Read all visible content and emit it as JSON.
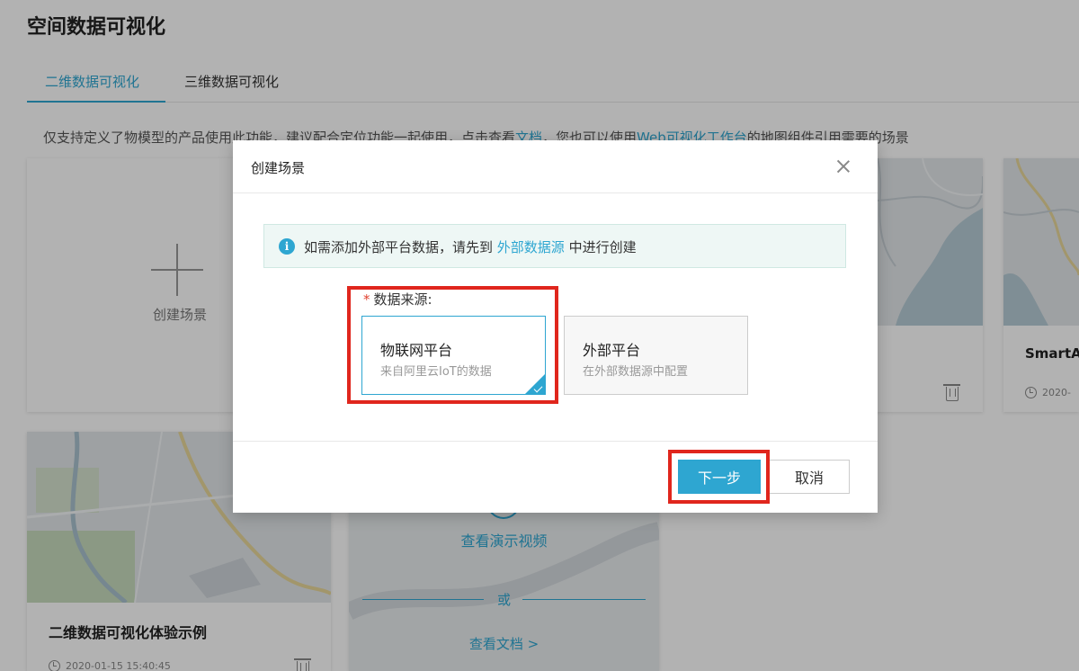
{
  "page": {
    "title": "空间数据可视化",
    "tabs": [
      {
        "label": "二维数据可视化",
        "active": true
      },
      {
        "label": "三维数据可视化",
        "active": false
      }
    ],
    "description": {
      "prefix": "仅支持定义了物模型的产品使用此功能，建议配合定位功能一起使用，点击查看",
      "doc_link": "文档",
      "middle": "，您也可以使用",
      "workbench_link": "Web可视化工作台",
      "suffix": "的地图组件引用需要的场景"
    }
  },
  "cards": {
    "create_label": "创建场景",
    "card_c_title": "SmartA",
    "card_c_date": "2020-",
    "card_d_title": "二维数据可视化体验示例",
    "card_d_date": "2020-01-15 15:40:45",
    "demo_video": "查看演示视频",
    "or": "或",
    "view_doc": "查看文档 >"
  },
  "modal": {
    "title": "创建场景",
    "alert": {
      "prefix": "如需添加外部平台数据，请先到",
      "link": "外部数据源",
      "suffix": "中进行创建",
      "icon": "info-icon"
    },
    "field_label": "数据来源:",
    "required_mark": "*",
    "options": [
      {
        "title": "物联网平台",
        "subtitle": "来自阿里云IoT的数据",
        "selected": true
      },
      {
        "title": "外部平台",
        "subtitle": "在外部数据源中配置",
        "selected": false
      }
    ],
    "next_button": "下一步",
    "cancel_button": "取消"
  },
  "colors": {
    "accent": "#2ea6d1",
    "highlight": "#e0261d",
    "required": "#e0412f"
  }
}
